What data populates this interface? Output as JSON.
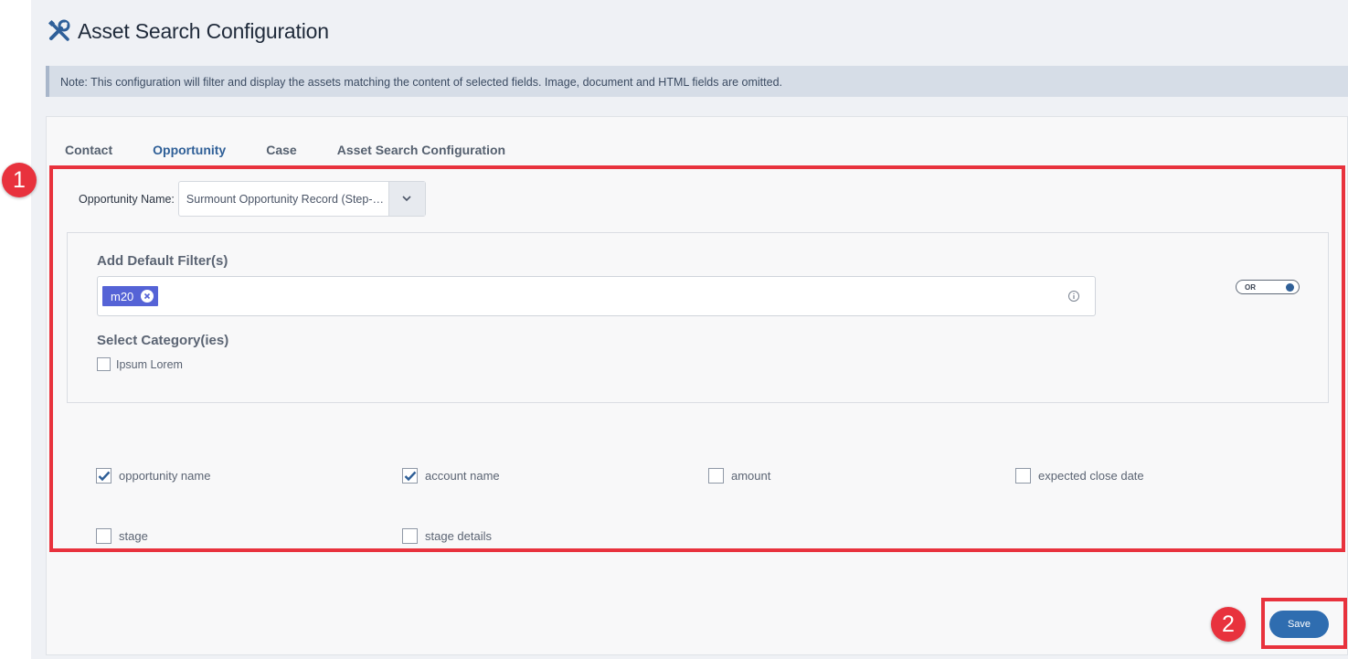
{
  "header": {
    "title": "Asset Search Configuration",
    "icon": "tools-icon"
  },
  "note": "Note: This configuration will filter and display the assets matching the content of selected fields. Image, document and HTML fields are omitted.",
  "tabs": [
    {
      "label": "Contact",
      "active": false
    },
    {
      "label": "Opportunity",
      "active": true
    },
    {
      "label": "Case",
      "active": false
    },
    {
      "label": "Asset Search Configuration",
      "active": false
    }
  ],
  "opportunity": {
    "label": "Opportunity Name:",
    "selected": "Surmount Opportunity Record (Step-…"
  },
  "filters": {
    "title": "Add Default Filter(s)",
    "chips": [
      "m20"
    ],
    "toggle_label": "OR",
    "category_title": "Select Category(ies)",
    "categories": [
      {
        "label": "Ipsum Lorem",
        "checked": false
      }
    ]
  },
  "fields": [
    {
      "label": "opportunity name",
      "checked": true
    },
    {
      "label": "account name",
      "checked": true
    },
    {
      "label": "amount",
      "checked": false
    },
    {
      "label": "expected close date",
      "checked": false
    },
    {
      "label": "stage",
      "checked": false
    },
    {
      "label": "stage details",
      "checked": false
    }
  ],
  "save_label": "Save",
  "annotations": {
    "step1": "1",
    "step2": "2"
  },
  "colors": {
    "accent": "#2f6db0",
    "chip": "#5563d6",
    "highlight": "#e8323d"
  }
}
